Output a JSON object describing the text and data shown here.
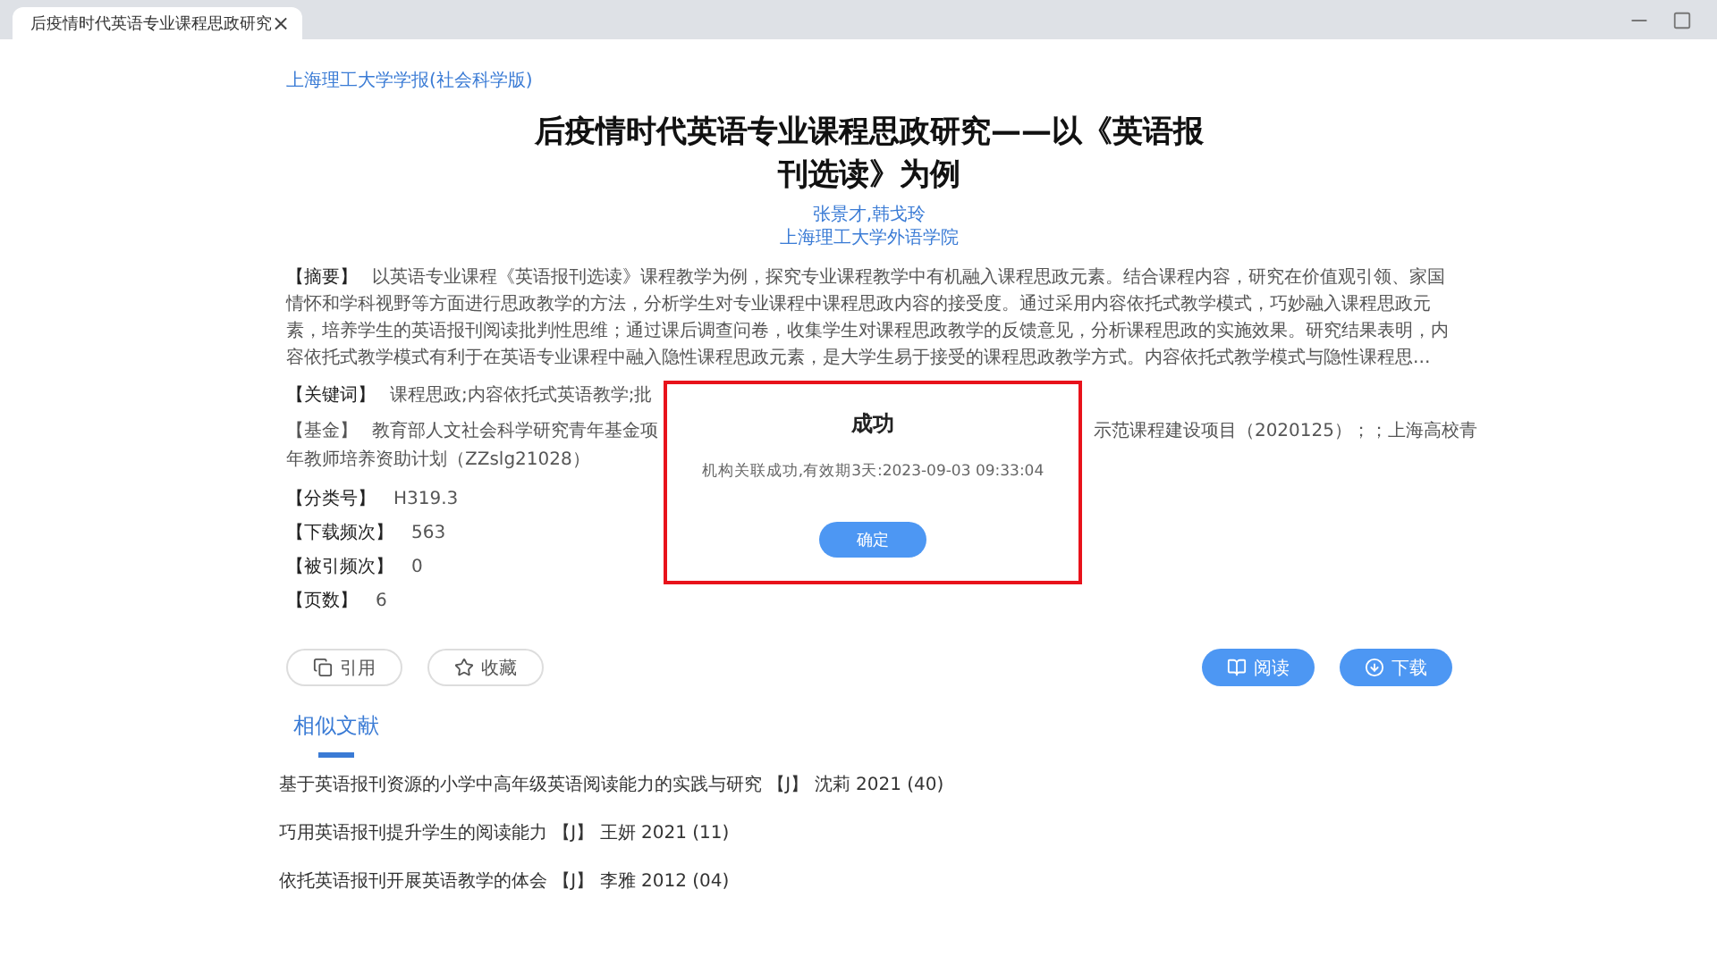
{
  "browser_tab": {
    "title": "后疫情时代英语专业课程思政研究",
    "close": "×"
  },
  "journal": "上海理工大学学报(社会科学版)",
  "title": "后疫情时代英语专业课程思政研究——以《英语报刊选读》为例",
  "authors": "张景才,韩戈玲",
  "affiliation": "上海理工大学外语学院",
  "abstract": {
    "label": "【摘要】",
    "text": "以英语专业课程《英语报刊选读》课程教学为例，探究专业课程教学中有机融入课程思政元素。结合课程内容，研究在价值观引领、家国情怀和学科视野等方面进行思政教学的方法，分析学生对专业课程中课程思政内容的接受度。通过采用内容依托式教学模式，巧妙融入课程思政元素，培养学生的英语报刊阅读批判性思维；通过课后调查问卷，收集学生对课程思政教学的反馈意见，分析课程思政的实施效果。研究结果表明，内容依托式教学模式有利于在英语专业课程中融入隐性课程思政元素，是大学生易于接受的课程思政教学方式。内容依托式教学模式与隐性课程思..."
  },
  "keywords": {
    "label": "【关键词】",
    "text": "课程思政;内容依托式英语教学;批"
  },
  "fund": {
    "label": "【基金】",
    "text_before": "教育部人文社会科学研究青年基金项",
    "text_after": "示范课程建设项目（2020125）；；上海高校青",
    "text_line2": "年教师培养资助计划（ZZslg21028）"
  },
  "fields": [
    {
      "label": "【分类号】",
      "value": "H319.3"
    },
    {
      "label": "【下载频次】",
      "value": "563"
    },
    {
      "label": "【被引频次】",
      "value": "0"
    },
    {
      "label": "【页数】",
      "value": "6"
    }
  ],
  "actions": [
    {
      "label": "引用",
      "kind": "outline"
    },
    {
      "label": "收藏",
      "kind": "outline"
    },
    {
      "label": "阅读",
      "kind": "primary"
    },
    {
      "label": "下载",
      "kind": "primary"
    }
  ],
  "tabs": [
    {
      "label": "相似文献",
      "selected": true
    }
  ],
  "related": [
    "基于英语报刊资源的小学中高年级英语阅读能力的实践与研究 【J】 沈莉 2021 (40)",
    "巧用英语报刊提升学生的阅读能力 【J】 王妍 2021 (11)",
    "依托英语报刊开展英语教学的体会 【J】 李雅 2012 (04)"
  ],
  "dialog": {
    "title": "成功",
    "message": "机构关联成功,有效期3天:2023-09-03 09:33:04",
    "button": "确定"
  }
}
